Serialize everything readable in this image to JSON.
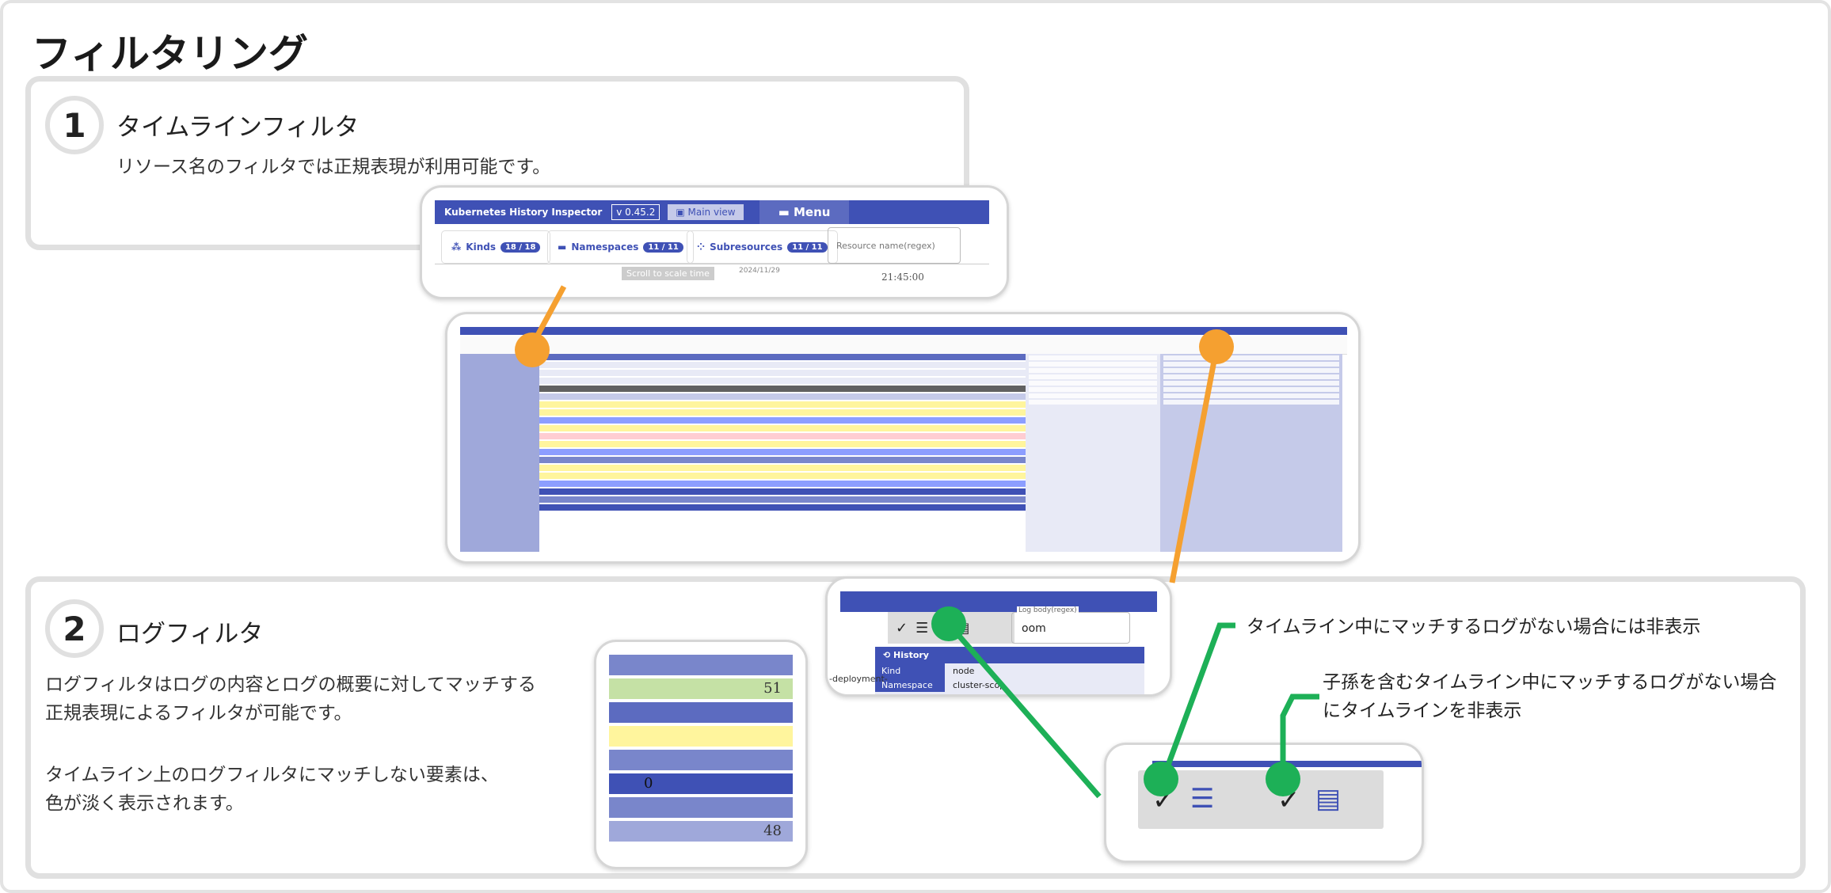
{
  "page": {
    "title": "フィルタリング"
  },
  "section1": {
    "number": "1",
    "title": "タイムラインフィルタ",
    "description": "リソース名のフィルタでは正規表現が利用可能です。"
  },
  "section2": {
    "number": "2",
    "title": "ログフィルタ",
    "description1": "ログフィルタはログの内容とログの概要に対してマッチする\n正規表現によるフィルタが可能です。",
    "description2": "タイムライン上のログフィルタにマッチしない要素は、\n色が淡く表示されます。"
  },
  "header_zoom": {
    "app_name": "Kubernetes History Inspector",
    "version": "v 0.45.2",
    "main_view": "Main view",
    "menu": "Menu",
    "kinds_label": "Kinds",
    "kinds_count": "18 / 18",
    "namespaces_label": "Namespaces",
    "namespaces_count": "11 / 11",
    "subresources_label": "Subresources",
    "subresources_count": "11 / 11",
    "resource_name_placeholder": "Resource name(regex)",
    "scroll_hint": "Scroll to scale time",
    "date": "2024/11/29",
    "time": "21:45:00"
  },
  "log_zoom": {
    "input_label": "Log body(regex)",
    "input_value": "oom",
    "history_header": "History",
    "kind_key": "Kind",
    "kind_value": "node",
    "namespace_key": "Namespace",
    "namespace_value": "cluster-scop",
    "deployment_text": "-deployment-"
  },
  "timeline_zoom": {
    "numbers": [
      "51",
      "0",
      "48"
    ]
  },
  "callouts": {
    "first": "タイムライン中にマッチするログがない場合には非表示",
    "second": "子孫を含むタイムライン中にマッチするログがない場合\nにタイムラインを非表示"
  },
  "colors": {
    "accent_orange": "#f5a030",
    "accent_green": "#1db057",
    "primary": "#3f51b5"
  }
}
